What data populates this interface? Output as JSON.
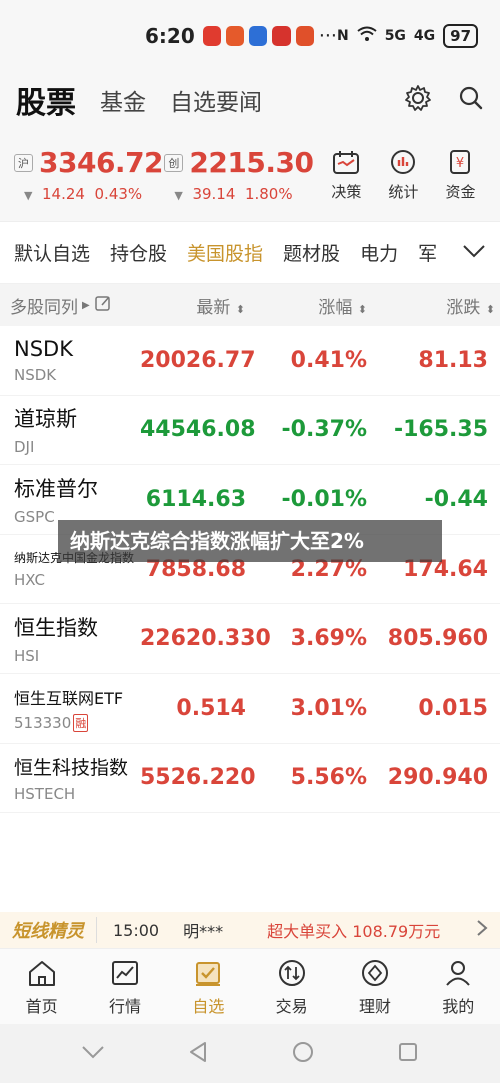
{
  "status": {
    "time": "6:20",
    "dots": "···",
    "network1": "5G",
    "network2": "4G",
    "battery": "97"
  },
  "top_tabs": [
    {
      "label": "股票"
    },
    {
      "label": "基金"
    },
    {
      "label": "自选要闻"
    }
  ],
  "indices": [
    {
      "tag": "沪",
      "value": "3346.72",
      "change": "14.24",
      "pct": "0.43%"
    },
    {
      "tag": "创",
      "value": "2215.30",
      "change": "39.14",
      "pct": "1.80%"
    }
  ],
  "tools": [
    {
      "label": "决策"
    },
    {
      "label": "统计"
    },
    {
      "label": "资金"
    }
  ],
  "watch_tabs": [
    {
      "label": "默认自选"
    },
    {
      "label": "持仓股"
    },
    {
      "label": "美国股指"
    },
    {
      "label": "题材股"
    },
    {
      "label": "电力"
    },
    {
      "label": "军"
    }
  ],
  "columns": {
    "compare": "多股同列",
    "price": "最新",
    "pct": "涨幅",
    "chg": "涨跌"
  },
  "rows": [
    {
      "name": "NSDK",
      "code": "NSDK",
      "price": "20026.77",
      "pct": "0.41%",
      "chg": "81.13",
      "dir": "up"
    },
    {
      "name": "道琼斯",
      "code": "DJI",
      "price": "44546.08",
      "pct": "-0.37%",
      "chg": "-165.35",
      "dir": "down"
    },
    {
      "name": "标准普尔",
      "code": "GSPC",
      "price": "6114.63",
      "pct": "-0.01%",
      "chg": "-0.44",
      "dir": "down"
    },
    {
      "name": "纳斯达克中国金龙指数",
      "code": "HXC",
      "price": "7858.68",
      "pct": "2.27%",
      "chg": "174.64",
      "dir": "up"
    },
    {
      "name": "恒生指数",
      "code": "HSI",
      "price": "22620.330",
      "pct": "3.69%",
      "chg": "805.960",
      "dir": "up"
    },
    {
      "name": "恒生互联网ETF",
      "code": "513330",
      "badge": "融",
      "price": "0.514",
      "pct": "3.01%",
      "chg": "0.015",
      "dir": "up"
    },
    {
      "name": "恒生科技指数",
      "code": "HSTECH",
      "price": "5526.220",
      "pct": "5.56%",
      "chg": "290.940",
      "dir": "up"
    }
  ],
  "banner": "纳斯达克综合指数涨幅扩大至2%",
  "ticker": {
    "logo": "短线精灵",
    "time": "15:00",
    "user": "明***",
    "message": "超大单买入 108.79万元"
  },
  "bottom_nav": [
    {
      "label": "首页"
    },
    {
      "label": "行情"
    },
    {
      "label": "自选"
    },
    {
      "label": "交易"
    },
    {
      "label": "理财"
    },
    {
      "label": "我的"
    }
  ],
  "colors": {
    "up": "#d9453a",
    "down": "#1d9a3a",
    "accent": "#c8942d"
  }
}
